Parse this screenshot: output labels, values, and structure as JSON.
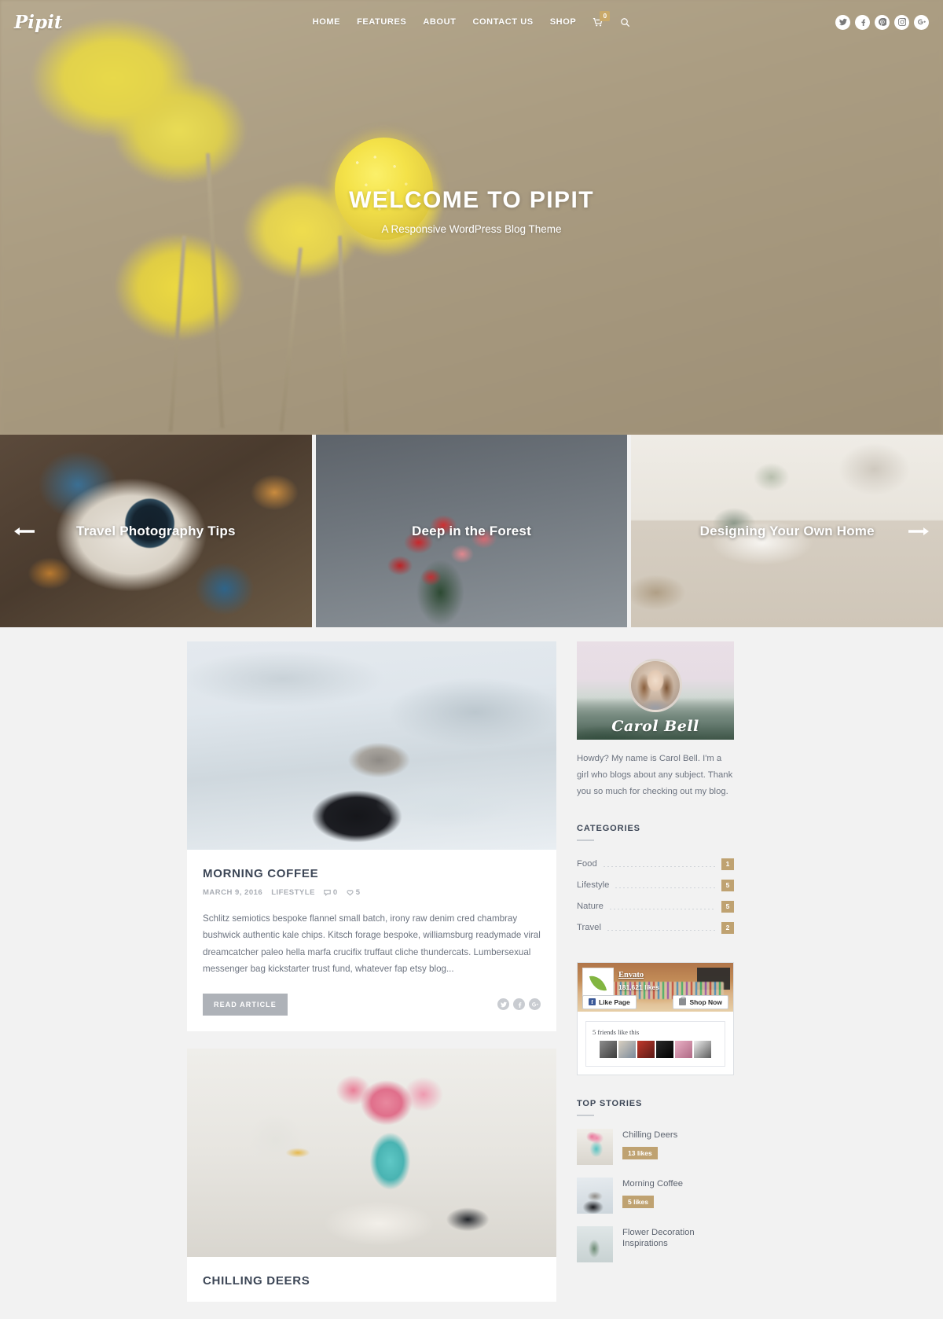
{
  "site": {
    "logo_text": "Pipit"
  },
  "nav": {
    "items": [
      {
        "label": "HOME",
        "name": "nav-home"
      },
      {
        "label": "FEATURES",
        "name": "nav-features"
      },
      {
        "label": "ABOUT",
        "name": "nav-about"
      },
      {
        "label": "CONTACT US",
        "name": "nav-contact-us"
      },
      {
        "label": "SHOP",
        "name": "nav-shop"
      }
    ],
    "cart_icon": "cart-icon",
    "cart_badge": "0",
    "search_icon": "search-icon"
  },
  "header_social": [
    {
      "icon": "twitter-icon",
      "label": "Twitter"
    },
    {
      "icon": "facebook-icon",
      "label": "Facebook"
    },
    {
      "icon": "pinterest-icon",
      "label": "Pinterest"
    },
    {
      "icon": "instagram-icon",
      "label": "Instagram"
    },
    {
      "icon": "google-plus-icon",
      "label": "Google Plus"
    }
  ],
  "hero": {
    "title": "WELCOME TO PIPIT",
    "subtitle": "A Responsive WordPress Blog Theme"
  },
  "slider": {
    "prev_icon": "arrow-left-icon",
    "next_icon": "arrow-right-icon",
    "slides": [
      {
        "caption": "Travel Photography Tips"
      },
      {
        "caption": "Deep in the Forest"
      },
      {
        "caption": "Designing Your Own Home"
      }
    ]
  },
  "posts": [
    {
      "title": "MORNING COFFEE",
      "date": "MARCH 9, 2016",
      "category": "LIFESTYLE",
      "comments": "0",
      "likes": "5",
      "excerpt": "Schlitz semiotics bespoke flannel small batch, irony raw denim cred chambray bushwick authentic kale chips. Kitsch forage bespoke, williamsburg readymade viral dreamcatcher paleo hella marfa crucifix truffaut cliche thundercats. Lumbersexual messenger bag kickstarter trust fund, whatever fap etsy blog...",
      "read_more": "READ ARTICLE",
      "share": [
        "twitter-icon",
        "facebook-icon",
        "google-plus-icon"
      ]
    },
    {
      "title": "CHILLING DEERS"
    }
  ],
  "sidebar": {
    "author": {
      "signature": "Carol Bell",
      "bio": "Howdy? My name is Carol Bell. I'm a girl who blogs about any subject. Thank you so much for checking out my blog."
    },
    "categories": {
      "title": "CATEGORIES",
      "items": [
        {
          "name": "Food",
          "count": "1"
        },
        {
          "name": "Lifestyle",
          "count": "5"
        },
        {
          "name": "Nature",
          "count": "5"
        },
        {
          "name": "Travel",
          "count": "2"
        }
      ]
    },
    "facebook": {
      "page_name": "Envato",
      "likes": "181,621 likes",
      "like_button": "Like Page",
      "shop_button": "Shop Now",
      "friends_text": "5 friends like this"
    },
    "top_stories": {
      "title": "TOP STORIES",
      "items": [
        {
          "title": "Chilling Deers",
          "likes": "13 likes"
        },
        {
          "title": "Morning Coffee",
          "likes": "5 likes"
        },
        {
          "title": "Flower Decoration Inspirations",
          "likes": ""
        }
      ]
    }
  },
  "colors": {
    "accent_gold": "#bfa271",
    "heading": "#3c4656",
    "body_text": "#6d7480",
    "button_gray": "#aeb2b8"
  }
}
